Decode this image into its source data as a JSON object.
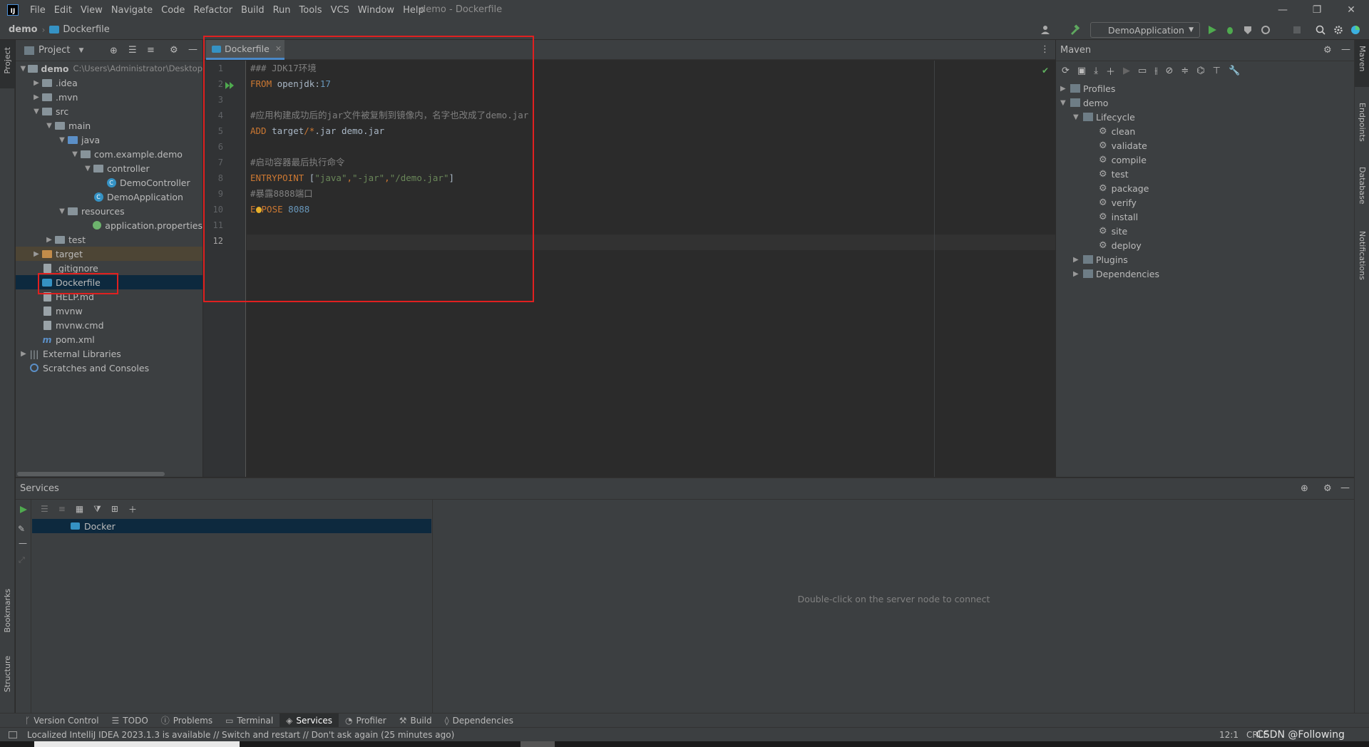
{
  "window": {
    "title": "demo - Dockerfile"
  },
  "menu": [
    "File",
    "Edit",
    "View",
    "Navigate",
    "Code",
    "Refactor",
    "Build",
    "Run",
    "Tools",
    "VCS",
    "Window",
    "Help"
  ],
  "breadcrumb": {
    "project": "demo",
    "file": "Dockerfile"
  },
  "toolbar": {
    "run_config": "DemoApplication"
  },
  "left_strip": {
    "project": "Project",
    "bookmarks": "Bookmarks",
    "structure": "Structure"
  },
  "right_strip": {
    "maven": "Maven",
    "endpoints": "Endpoints",
    "database": "Database",
    "notifications": "Notifications"
  },
  "project_panel": {
    "title": "Project",
    "tree": [
      {
        "label": "demo",
        "extra": "C:\\Users\\Administrator\\Desktop",
        "bold": true
      },
      {
        "label": ".idea"
      },
      {
        "label": ".mvn"
      },
      {
        "label": "src"
      },
      {
        "label": "main"
      },
      {
        "label": "java"
      },
      {
        "label": "com.example.demo"
      },
      {
        "label": "controller"
      },
      {
        "label": "DemoController"
      },
      {
        "label": "DemoApplication"
      },
      {
        "label": "resources"
      },
      {
        "label": "application.properties"
      },
      {
        "label": "test"
      },
      {
        "label": "target"
      },
      {
        "label": ".gitignore"
      },
      {
        "label": "Dockerfile"
      },
      {
        "label": "HELP.md"
      },
      {
        "label": "mvnw"
      },
      {
        "label": "mvnw.cmd"
      },
      {
        "label": "pom.xml"
      },
      {
        "label": "External Libraries"
      },
      {
        "label": "Scratches and Consoles"
      }
    ]
  },
  "editor": {
    "tab": "Dockerfile",
    "line_numbers": [
      "1",
      "2",
      "3",
      "4",
      "5",
      "6",
      "7",
      "8",
      "9",
      "10",
      "11",
      "12"
    ],
    "lines": {
      "l1": "### JDK17环境",
      "l2_kw": "FROM",
      "l2_img": " openjdk:",
      "l2_ver": "17",
      "l4": "#应用构建成功后的jar文件被复制到镜像内，名字也改成了demo.jar",
      "l5_kw": "ADD",
      "l5_a": " target",
      "l5_b": "/*",
      "l5_c": ".jar demo.jar",
      "l7": "#启动容器最后执行命令",
      "l8_kw": "ENTRYPOINT",
      "l8_a": " [",
      "l8_s1": "\"java\"",
      "l8_c1": ",",
      "l8_s2": "\"-jar\"",
      "l8_c2": ",",
      "l8_s3": "\"/demo.jar\"",
      "l8_b": "]",
      "l10": "#暴露8888端口",
      "l11_kw_a": "E",
      "l11_kw_b": "POSE",
      "l11_num": " 8088"
    }
  },
  "maven": {
    "title": "Maven",
    "tree": {
      "profiles": "Profiles",
      "demo": "demo",
      "lifecycle": "Lifecycle",
      "goals": [
        "clean",
        "validate",
        "compile",
        "test",
        "package",
        "verify",
        "install",
        "site",
        "deploy"
      ],
      "plugins": "Plugins",
      "dependencies": "Dependencies"
    }
  },
  "services": {
    "title": "Services",
    "node": "Docker",
    "hint": "Double-click on the server node to connect"
  },
  "bottom_tabs": [
    "Version Control",
    "TODO",
    "Problems",
    "Terminal",
    "Services",
    "Profiler",
    "Build",
    "Dependencies"
  ],
  "status": {
    "message": "Localized IntelliJ IDEA 2023.1.3 is available // Switch and restart // Don't ask again (25 minutes ago)",
    "position": "12:1",
    "encoding": "CRLF",
    "watermark": "CSDN @Following"
  }
}
